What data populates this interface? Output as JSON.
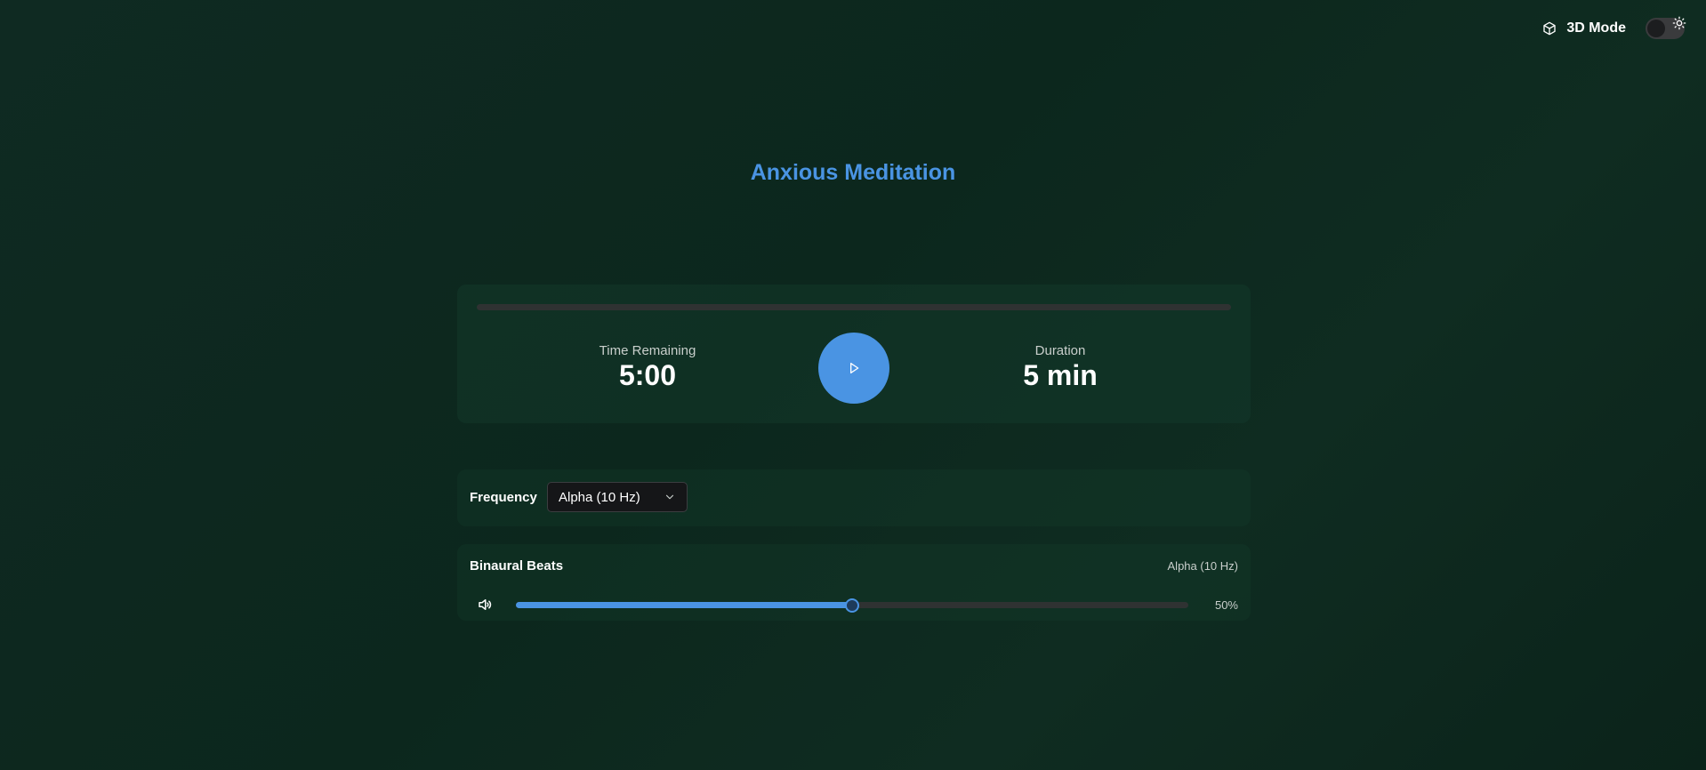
{
  "header": {
    "mode_label": "3D Mode",
    "mode_enabled": false,
    "icons": {
      "mode": "cube-icon",
      "theme": "sun-icon"
    }
  },
  "title": "Anxious Meditation",
  "player": {
    "progress": 0,
    "time_remaining_label": "Time Remaining",
    "time_remaining_value": "5:00",
    "duration_label": "Duration",
    "duration_value": "5 min",
    "play_icon": "play-icon"
  },
  "frequency": {
    "label": "Frequency",
    "selected": "Alpha (10 Hz)",
    "icon": "chevron-down-icon"
  },
  "binaural": {
    "title": "Binaural Beats",
    "frequency_text": "Alpha (10 Hz)",
    "volume": 0.5,
    "volume_text": "50%",
    "icon": "volume-icon"
  },
  "colors": {
    "accent": "#4a94e3",
    "background": "#0f2a22",
    "track": "#2f3232"
  }
}
